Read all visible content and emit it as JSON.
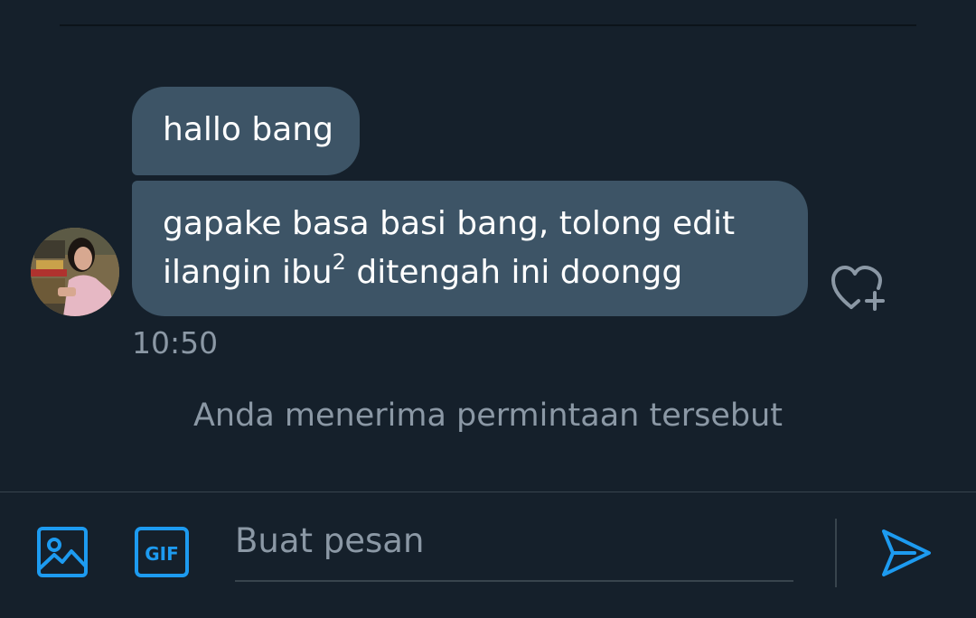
{
  "messages": [
    {
      "text": "hallo bang"
    },
    {
      "line1": "gapake basa basi bang, tolong edit",
      "line2_pre": "ilangin ibu",
      "line2_sup": "2",
      "line2_post": " ditengah ini doongg"
    }
  ],
  "timestamp": "10:50",
  "system_notice": "Anda menerima permintaan tersebut",
  "composer": {
    "placeholder": "Buat pesan",
    "value": "",
    "gif_label": "GIF"
  },
  "icons": {
    "react": "heart-plus-icon",
    "media": "image-icon",
    "gif": "gif-icon",
    "send": "send-icon"
  },
  "colors": {
    "background": "#15202b",
    "bubble": "#3d5466",
    "accent": "#1d9bf0",
    "muted_text": "#8b98a5"
  }
}
